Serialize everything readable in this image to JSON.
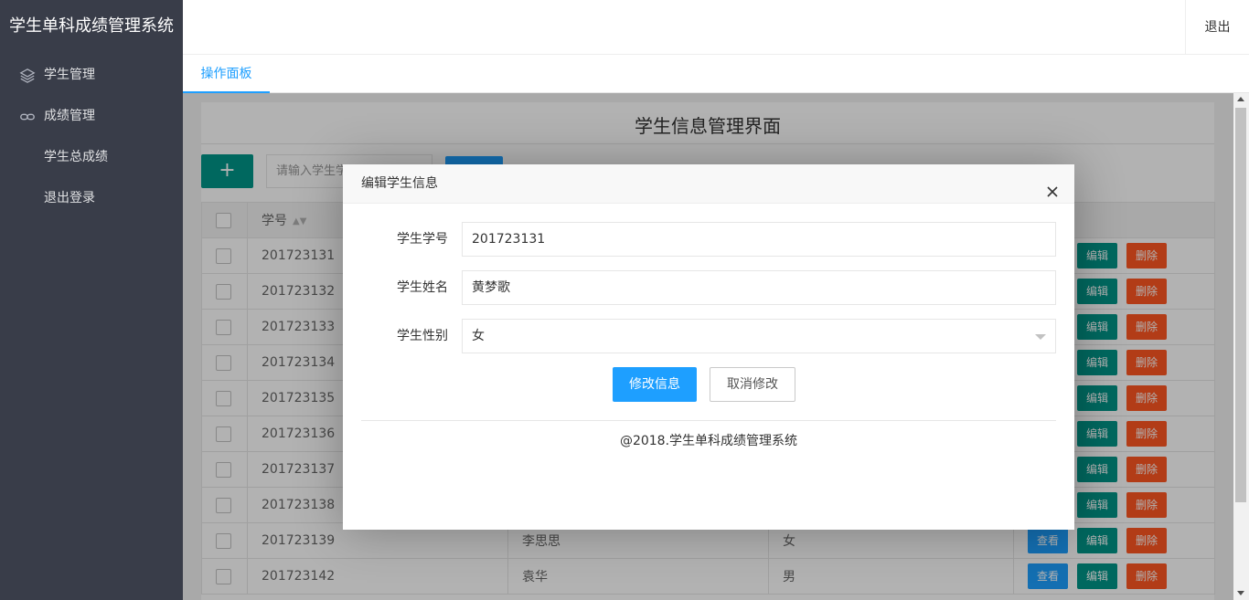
{
  "app": {
    "title": "学生单科成绩管理系统"
  },
  "header": {
    "logout_label": "退出"
  },
  "sidebar": {
    "items": [
      {
        "label": "学生管理",
        "icon": "layers-icon"
      },
      {
        "label": "成绩管理",
        "icon": "link-icon"
      },
      {
        "label": "学生总成绩"
      },
      {
        "label": "退出登录"
      }
    ]
  },
  "tabs": [
    {
      "label": "操作面板"
    }
  ],
  "panel": {
    "title": "学生信息管理界面",
    "add_label": "+",
    "search_placeholder": "请输入学生学号"
  },
  "table": {
    "headers": {
      "id": "学号"
    },
    "actions": {
      "view": "查看",
      "edit": "编辑",
      "delete": "删除"
    },
    "rows": [
      {
        "id": "201723131",
        "name": "",
        "gender": ""
      },
      {
        "id": "201723132",
        "name": "",
        "gender": ""
      },
      {
        "id": "201723133",
        "name": "",
        "gender": ""
      },
      {
        "id": "201723134",
        "name": "",
        "gender": ""
      },
      {
        "id": "201723135",
        "name": "",
        "gender": ""
      },
      {
        "id": "201723136",
        "name": "",
        "gender": ""
      },
      {
        "id": "201723137",
        "name": "",
        "gender": ""
      },
      {
        "id": "201723138",
        "name": "",
        "gender": ""
      },
      {
        "id": "201723139",
        "name": "李思思",
        "gender": "女"
      },
      {
        "id": "201723142",
        "name": "袁华",
        "gender": "男"
      }
    ]
  },
  "dialog": {
    "title": "编辑学生信息",
    "fields": [
      {
        "label": "学生学号",
        "value": "201723131"
      },
      {
        "label": "学生姓名",
        "value": "黄梦歌"
      },
      {
        "label": "学生性别",
        "value": "女"
      }
    ],
    "submit_label": "修改信息",
    "cancel_label": "取消修改",
    "footer": "@2018.学生单科成绩管理系统"
  }
}
